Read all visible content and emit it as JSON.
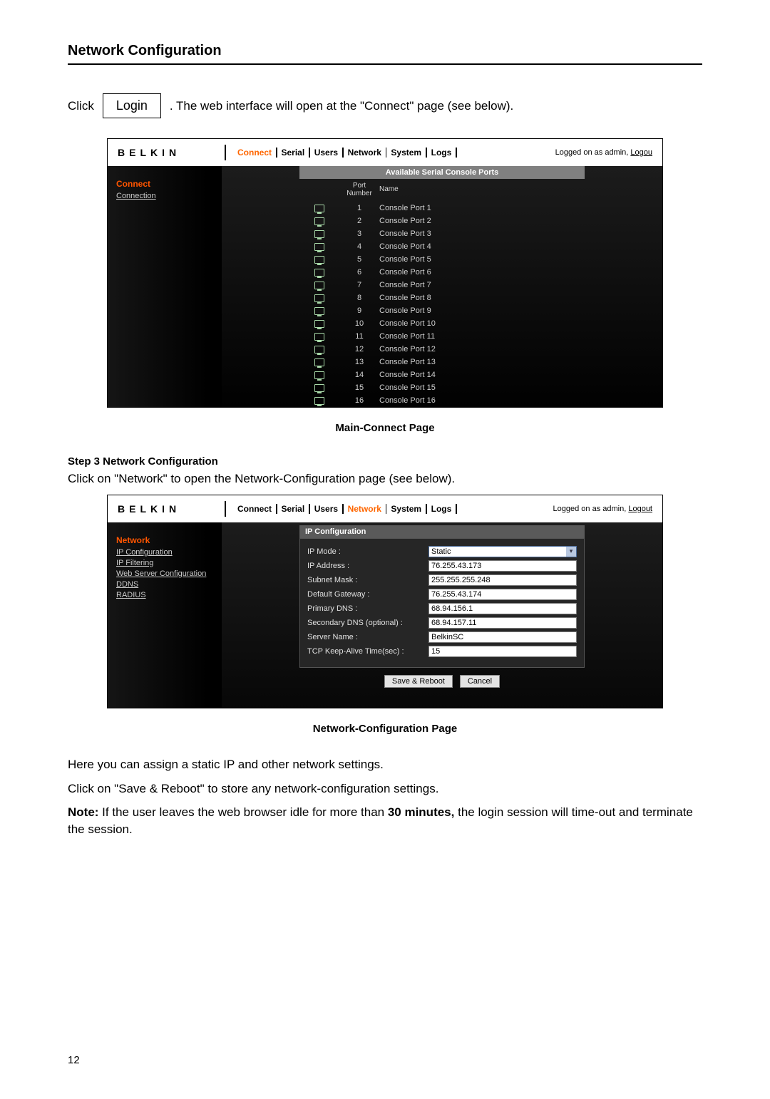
{
  "section_title": "Network Configuration",
  "click_row": {
    "before": "Click",
    "button": "Login",
    "after": ". The web interface will open at the \"Connect\" page (see below)."
  },
  "brand": "BELKIN",
  "logged_on_prefix": "Logged on as admin, ",
  "logout_full": "Logout",
  "logout_truncated": "Logou",
  "top_tabs": [
    "Connect",
    "Serial",
    "Users",
    "Network",
    "System",
    "Logs"
  ],
  "screenshot1": {
    "side_head": "Connect",
    "side_links": [
      "Connection"
    ],
    "table_title": "Available Serial Console Ports",
    "col_port": "Port Number",
    "col_name": "Name",
    "rows": [
      {
        "num": "1",
        "name": "Console Port 1"
      },
      {
        "num": "2",
        "name": "Console Port 2"
      },
      {
        "num": "3",
        "name": "Console Port 3"
      },
      {
        "num": "4",
        "name": "Console Port 4"
      },
      {
        "num": "5",
        "name": "Console Port 5"
      },
      {
        "num": "6",
        "name": "Console Port 6"
      },
      {
        "num": "7",
        "name": "Console Port 7"
      },
      {
        "num": "8",
        "name": "Console Port 8"
      },
      {
        "num": "9",
        "name": "Console Port 9"
      },
      {
        "num": "10",
        "name": "Console Port 10"
      },
      {
        "num": "11",
        "name": "Console Port 11"
      },
      {
        "num": "12",
        "name": "Console Port 12"
      },
      {
        "num": "13",
        "name": "Console Port 13"
      },
      {
        "num": "14",
        "name": "Console Port 14"
      },
      {
        "num": "15",
        "name": "Console Port 15"
      },
      {
        "num": "16",
        "name": "Console Port 16"
      }
    ]
  },
  "caption1": "Main-Connect Page",
  "step3": "Step 3 Network Configuration",
  "step3_text": "Click on \"Network\" to open the Network-Configuration page (see below).",
  "screenshot2": {
    "side_head": "Network",
    "side_links": [
      "IP Configuration",
      "IP Filtering",
      "Web Server Configuration",
      "DDNS",
      "RADIUS"
    ],
    "panel_title": "IP Configuration",
    "fields": [
      {
        "label": "IP Mode :",
        "value": "Static",
        "type": "select"
      },
      {
        "label": "IP Address :",
        "value": "76.255.43.173",
        "type": "text"
      },
      {
        "label": "Subnet Mask :",
        "value": "255.255.255.248",
        "type": "text"
      },
      {
        "label": "Default Gateway :",
        "value": "76.255.43.174",
        "type": "text"
      },
      {
        "label": "Primary DNS :",
        "value": "68.94.156.1",
        "type": "text"
      },
      {
        "label": "Secondary DNS (optional) :",
        "value": "68.94.157.11",
        "type": "text"
      },
      {
        "label": "Server Name :",
        "value": "BelkinSC",
        "type": "text"
      },
      {
        "label": "TCP Keep-Alive Time(sec) :",
        "value": "15",
        "type": "text"
      }
    ],
    "buttons": {
      "save": "Save & Reboot",
      "cancel": "Cancel"
    }
  },
  "caption2": "Network-Configuration Page",
  "body2": "Here you can assign a static IP and other network settings.",
  "body3": "Click on \"Save & Reboot\" to store any network-configuration settings.",
  "note_label": "Note:",
  "note_part1": " If the user leaves the web browser idle for more than ",
  "note_bold": "30 minutes,",
  "note_part2": " the login session will time-out and terminate the session.",
  "page_number": "12"
}
